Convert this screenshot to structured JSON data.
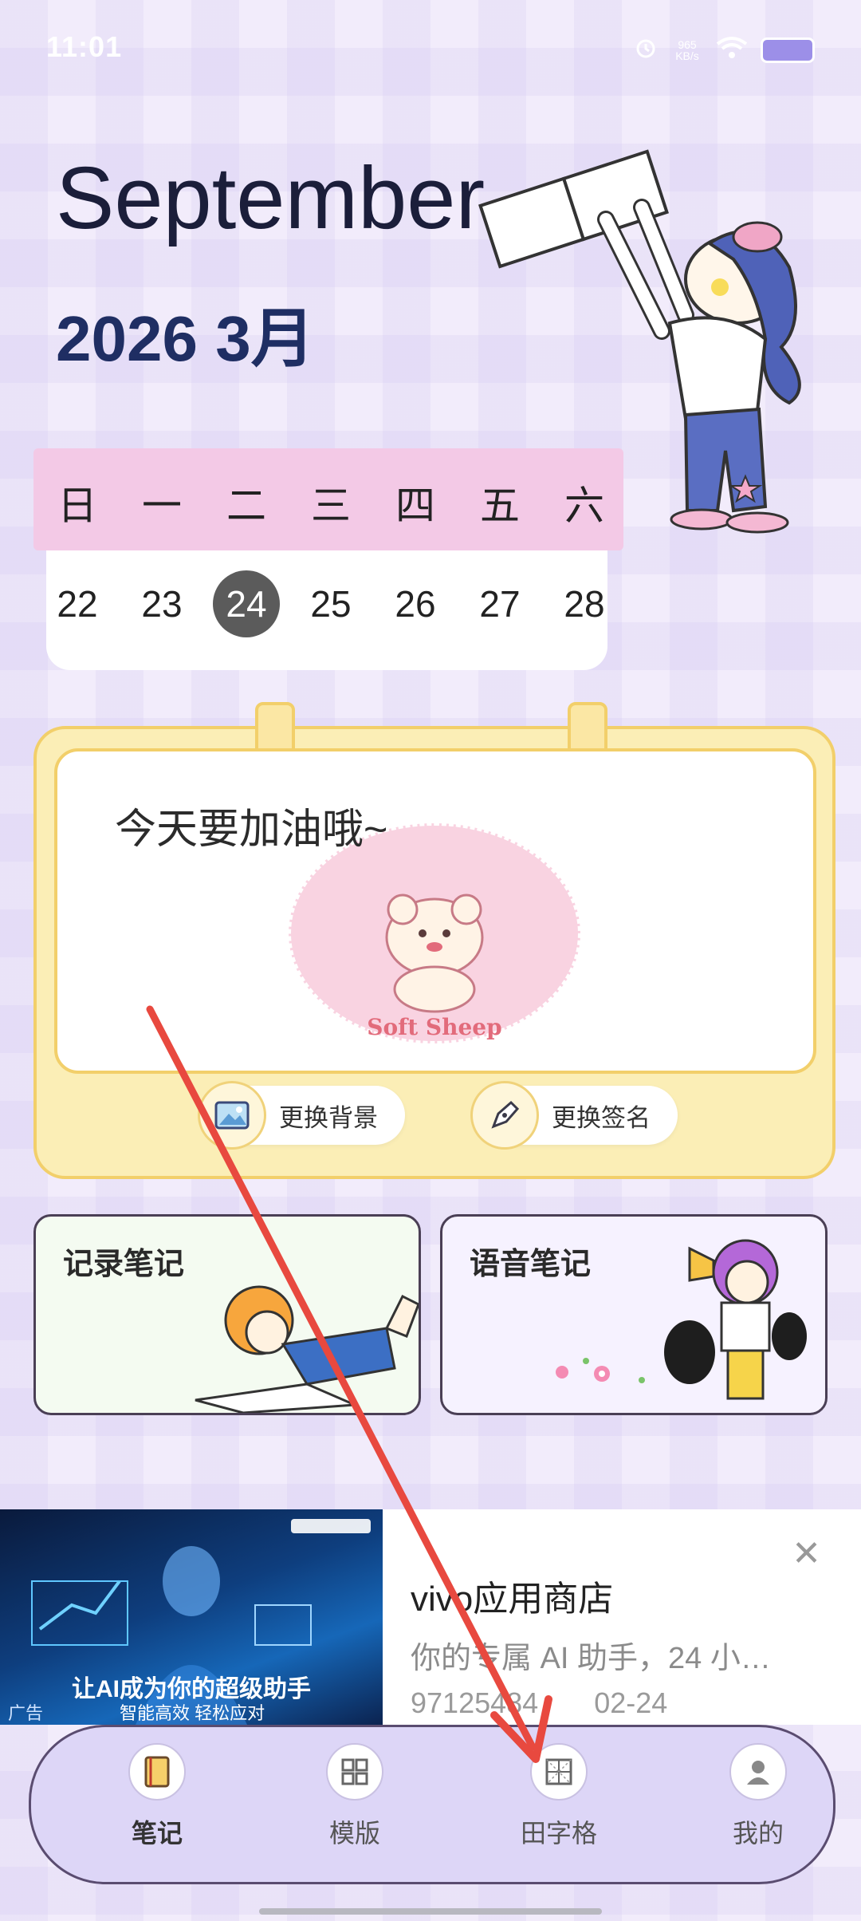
{
  "status_bar": {
    "time": "11:01",
    "network_speed": "965 KB/s"
  },
  "header": {
    "month": "September",
    "year_month": "2026 3月"
  },
  "calendar": {
    "weekdays": [
      "日",
      "一",
      "二",
      "三",
      "四",
      "五",
      "六"
    ],
    "dates": [
      "22",
      "23",
      "24",
      "25",
      "26",
      "27",
      "28"
    ],
    "selected": "24"
  },
  "board": {
    "slogan": "今天要加油哦~",
    "image_caption": "Soft Sheep",
    "change_background_label": "更换背景",
    "change_signature_label": "更换签名"
  },
  "cards": {
    "record_note": "记录笔记",
    "voice_note": "语音笔记"
  },
  "ad": {
    "image_headline": "让AI成为你的超级助手",
    "image_subline": "智能高效  轻松应对",
    "tag": "广告",
    "title": "vivo应用商店",
    "description": "你的专属 AI 助手，24 小…",
    "meta_id": "97125484",
    "meta_date": "02-24"
  },
  "bottom_nav": {
    "items": [
      {
        "label": "笔记",
        "icon": "notebook-icon",
        "active": true
      },
      {
        "label": "模版",
        "icon": "template-grid-icon",
        "active": false
      },
      {
        "label": "田字格",
        "icon": "tian-grid-icon",
        "active": false
      },
      {
        "label": "我的",
        "icon": "profile-icon",
        "active": false
      }
    ]
  },
  "colors": {
    "accent_arrow": "#e8493f",
    "nav_bg": "#ddd6f7",
    "board_yellow": "#fbeeb6"
  }
}
